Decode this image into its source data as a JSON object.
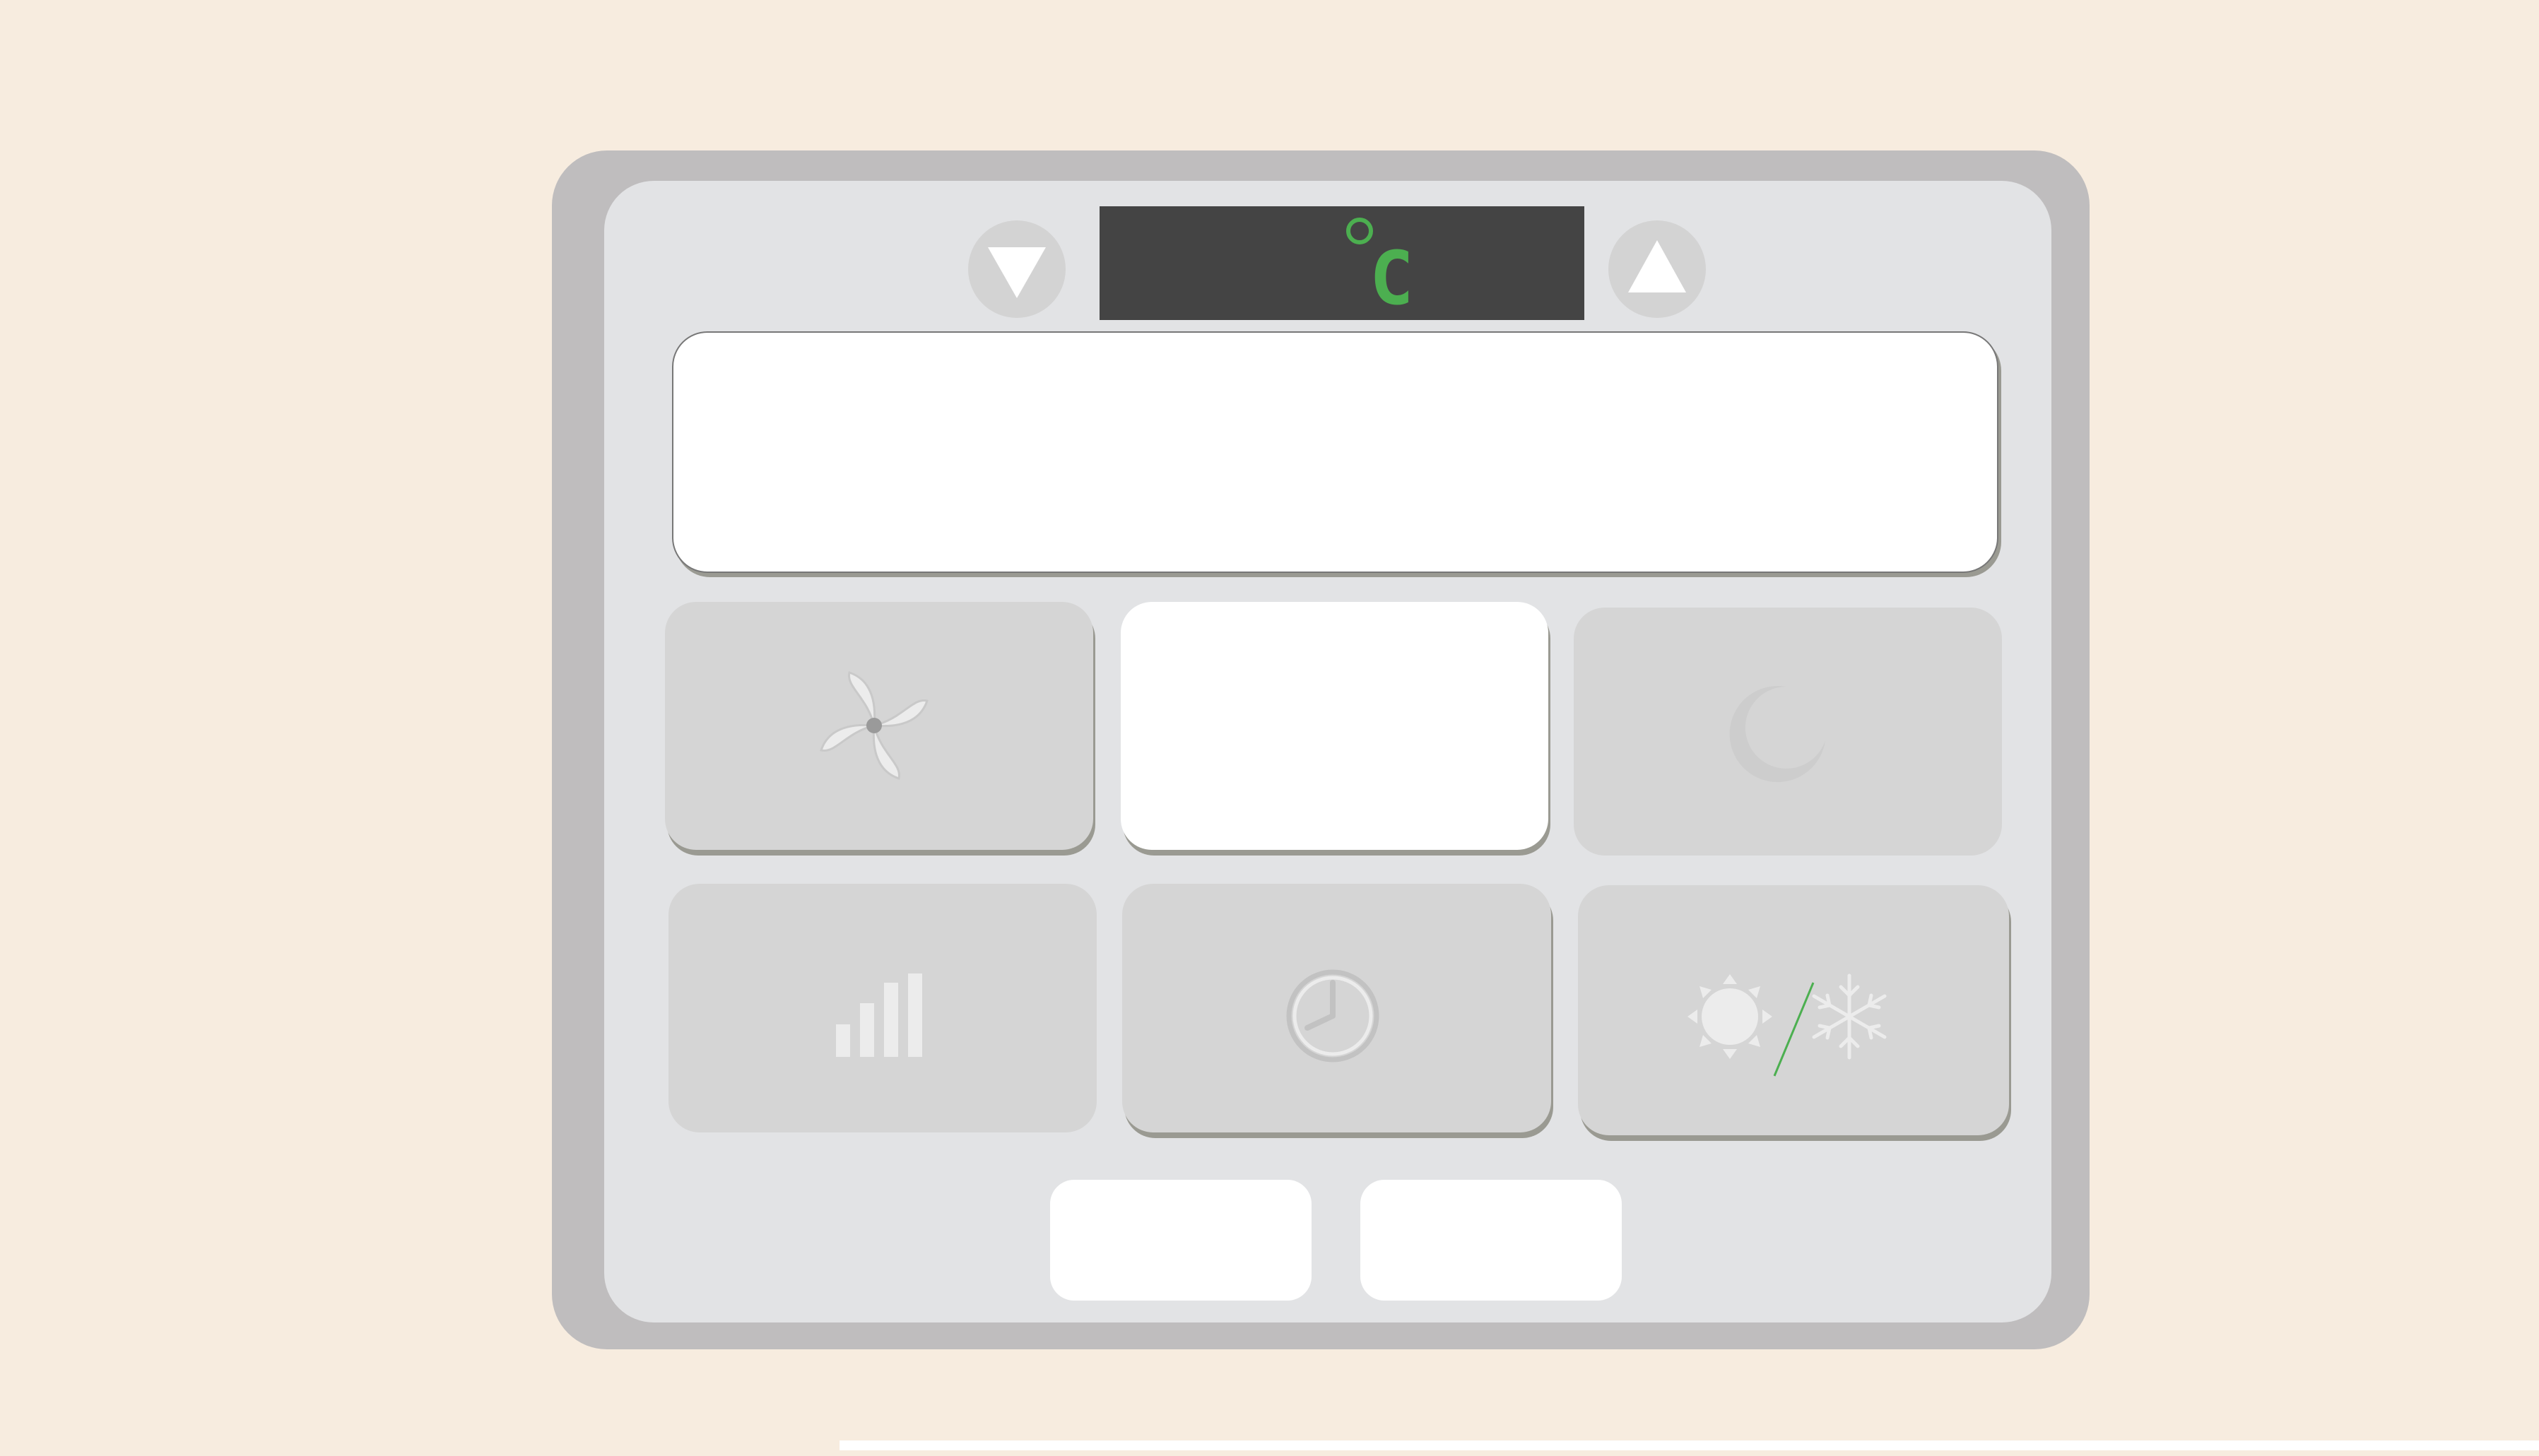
{
  "display": {
    "temperature_unit": "C",
    "unit_color": "#4caf50"
  },
  "controls": {
    "decrease": {
      "icon": "triangle-down-icon"
    },
    "increase": {
      "icon": "triangle-up-icon"
    }
  },
  "tiles": [
    {
      "id": "fan",
      "icon": "fan-icon"
    },
    {
      "id": "blank",
      "icon": ""
    },
    {
      "id": "sleep",
      "icon": "moon-icon"
    },
    {
      "id": "fan-speed",
      "icon": "signal-bars-icon"
    },
    {
      "id": "timer",
      "icon": "clock-icon"
    },
    {
      "id": "mode",
      "icon": "sun-snowflake-icon"
    }
  ],
  "colors": {
    "background": "#f7ecdf",
    "panel_frame": "#bfbdbe",
    "panel_face": "#e2e3e5",
    "lcd_background": "#444444",
    "tile": "#d5d5d5"
  }
}
